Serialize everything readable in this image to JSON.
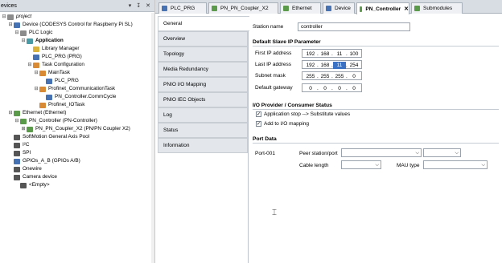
{
  "left_panel": {
    "title": "evices",
    "header_icons": [
      "▾",
      "↧",
      "✕"
    ],
    "tree": [
      {
        "label": "project",
        "indent": 0,
        "expander": "⊟",
        "icon": "gray",
        "style": "italic",
        "name": "tree-project"
      },
      {
        "label": "Device (CODESYS Control for Raspberry Pi SL)",
        "indent": 1,
        "expander": "⊟",
        "icon": "blue",
        "name": "tree-device"
      },
      {
        "label": "PLC Logic",
        "indent": 2,
        "expander": "⊟",
        "icon": "gray",
        "name": "tree-plc-logic"
      },
      {
        "label": "Application",
        "indent": 3,
        "expander": "⊟",
        "icon": "teal",
        "style": "bold",
        "name": "tree-application"
      },
      {
        "label": "Library Manager",
        "indent": 4,
        "expander": "",
        "icon": "yellow",
        "name": "tree-library-manager"
      },
      {
        "label": "PLC_PRG (PRG)",
        "indent": 4,
        "expander": "",
        "icon": "blue",
        "name": "tree-plc-prg"
      },
      {
        "label": "Task Configuration",
        "indent": 4,
        "expander": "⊟",
        "icon": "orange",
        "name": "tree-task-configuration"
      },
      {
        "label": "MainTask",
        "indent": 5,
        "expander": "⊟",
        "icon": "orange",
        "name": "tree-maintask"
      },
      {
        "label": "PLC_PRG",
        "indent": 6,
        "expander": "",
        "icon": "blue",
        "name": "tree-maintask-plc-prg"
      },
      {
        "label": "Profinet_CommunicationTask",
        "indent": 5,
        "expander": "⊟",
        "icon": "orange",
        "name": "tree-profinet-commtask"
      },
      {
        "label": "PN_Controller.CommCycle",
        "indent": 6,
        "expander": "",
        "icon": "blue",
        "name": "tree-commcycle"
      },
      {
        "label": "Profinet_IOTask",
        "indent": 5,
        "expander": "",
        "icon": "orange",
        "name": "tree-profinet-iotask"
      },
      {
        "label": "Ethernet (Ethernet)",
        "indent": 1,
        "expander": "⊟",
        "icon": "green",
        "name": "tree-ethernet"
      },
      {
        "label": "PN_Controller (PN-Controller)",
        "indent": 2,
        "expander": "⊟",
        "icon": "green",
        "name": "tree-pn-controller"
      },
      {
        "label": "PN_PN_Coupler_X2 (PN/PN Coupler X2)",
        "indent": 3,
        "expander": "⊞",
        "icon": "green",
        "name": "tree-pn-coupler"
      },
      {
        "label": "SoftMotion General Axis Pool",
        "indent": 1,
        "expander": "",
        "icon": "dark",
        "name": "tree-softmotion"
      },
      {
        "label": "I²C",
        "indent": 1,
        "expander": "",
        "icon": "dark",
        "name": "tree-i2c"
      },
      {
        "label": "SPI",
        "indent": 1,
        "expander": "",
        "icon": "dark",
        "name": "tree-spi"
      },
      {
        "label": "GPIOs_A_B (GPIOs A/B)",
        "indent": 1,
        "expander": "",
        "icon": "blue",
        "name": "tree-gpios"
      },
      {
        "label": "Onewire",
        "indent": 1,
        "expander": "",
        "icon": "dark",
        "name": "tree-onewire"
      },
      {
        "label": "Camera device",
        "indent": 1,
        "expander": "",
        "icon": "dark",
        "name": "tree-camera"
      },
      {
        "label": "<Empty>",
        "indent": 2,
        "expander": "",
        "icon": "dark",
        "name": "tree-empty"
      }
    ]
  },
  "tabs": [
    {
      "label": "PLC_PRG",
      "icon": "blue",
      "name": "tab-plc-prg",
      "active": false
    },
    {
      "label": "PN_PN_Coupler_X2",
      "icon": "green",
      "name": "tab-pn-coupler",
      "active": false
    },
    {
      "label": "Ethernet",
      "icon": "green",
      "name": "tab-ethernet",
      "active": false
    },
    {
      "label": "Device",
      "icon": "blue",
      "name": "tab-device",
      "active": false
    },
    {
      "label": "PN_Controller",
      "icon": "green",
      "name": "tab-pn-controller",
      "active": true,
      "close": "✕"
    },
    {
      "label": "Submodules",
      "icon": "green",
      "name": "tab-submodules",
      "active": false
    }
  ],
  "side_tabs": [
    {
      "label": "General",
      "active": true
    },
    {
      "label": "Overview"
    },
    {
      "label": "Topology"
    },
    {
      "label": "Media Redundancy"
    },
    {
      "label": "PNIO I/O Mapping"
    },
    {
      "label": "PNIO IEC Objects"
    },
    {
      "label": "Log"
    },
    {
      "label": "Status"
    },
    {
      "label": "Information"
    }
  ],
  "general": {
    "station_name_label": "Station name",
    "station_name_value": "controller",
    "ip_section_title": "Default Slave IP Parameter",
    "first_ip_label": "First IP address",
    "first_ip": [
      "192",
      "168",
      "11",
      "100"
    ],
    "last_ip_label": "Last IP address",
    "last_ip": [
      "192",
      "168",
      "11",
      "254"
    ],
    "subnet_label": "Subnet mask",
    "subnet": [
      "255",
      "255",
      "255",
      "0"
    ],
    "gateway_label": "Default gateway",
    "gateway": [
      "0",
      "0",
      "0",
      "0"
    ],
    "io_section_title": "I/O Provider / Consumer Status",
    "check_app_stop": "Application stop --> Substitute values",
    "check_add_mapping": "Add to I/O mapping",
    "port_section_title": "Port Data",
    "port_label": "Port-001",
    "peer_label": "Peer station/port",
    "cable_label": "Cable length",
    "mau_label": "MAU type"
  },
  "colors": {
    "selection": "#3b72c4",
    "header_bg": "#d8dde3"
  }
}
